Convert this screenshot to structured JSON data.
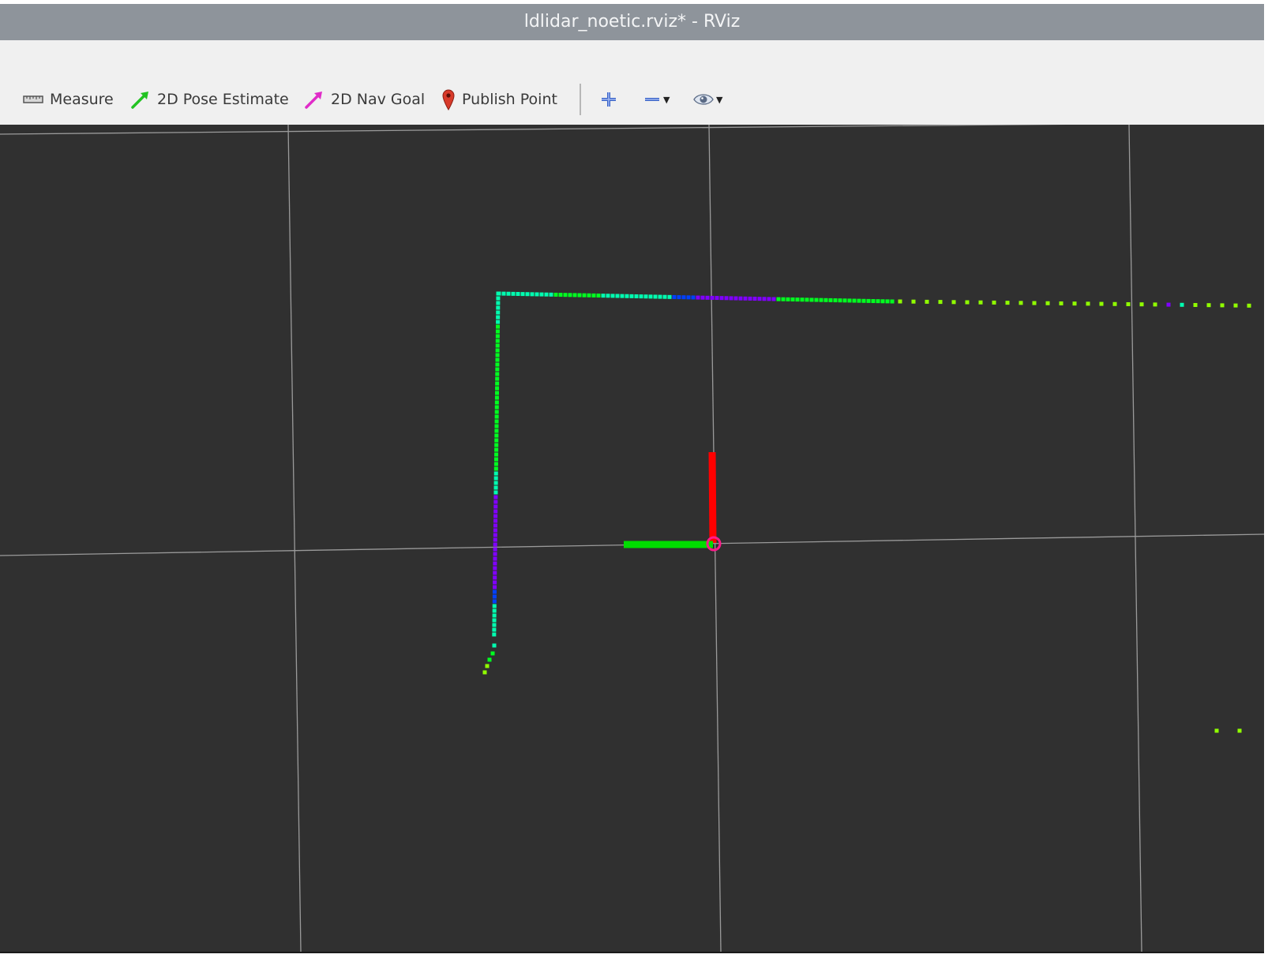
{
  "window": {
    "title": "ldlidar_noetic.rviz* - RViz"
  },
  "toolbar": {
    "measure": {
      "label": "Measure",
      "icon": "ruler-icon"
    },
    "pose_estimate": {
      "label": "2D Pose Estimate",
      "icon": "green-arrow-icon",
      "color": "#22c322"
    },
    "nav_goal": {
      "label": "2D Nav Goal",
      "icon": "magenta-arrow-icon",
      "color": "#e02cc8"
    },
    "publish_point": {
      "label": "Publish Point",
      "icon": "map-pin-icon",
      "color": "#d83a2a"
    },
    "add_tool": {
      "icon": "plus-icon"
    },
    "remove_tool": {
      "icon": "minus-icon"
    },
    "view_options": {
      "icon": "eye-icon"
    }
  },
  "viewport": {
    "background": "#303030",
    "grid_color": "#a0a0a0",
    "axis_x_color": "#ff0000",
    "axis_y_color": "#00dd00",
    "laser_colors": [
      "#00ff20",
      "#00ffb0",
      "#0040ff",
      "#8000ff",
      "#90ff00"
    ]
  }
}
